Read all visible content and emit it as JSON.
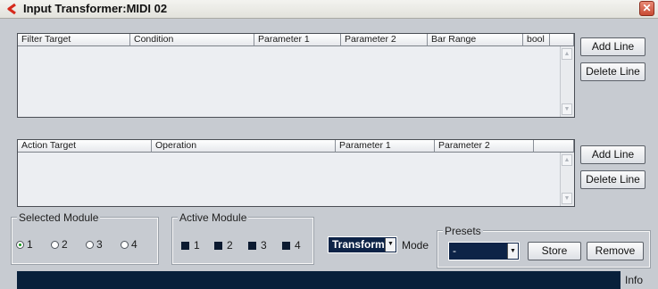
{
  "window": {
    "title": "Input Transformer:MIDI 02",
    "close_glyph": "✕"
  },
  "filter_table": {
    "columns": [
      "Filter Target",
      "Condition",
      "Parameter 1",
      "Parameter 2",
      "Bar Range",
      "bool"
    ]
  },
  "action_table": {
    "columns": [
      "Action Target",
      "Operation",
      "Parameter 1",
      "Parameter 2"
    ]
  },
  "filter_buttons": {
    "add": "Add Line",
    "delete": "Delete Line"
  },
  "action_buttons": {
    "add": "Add Line",
    "delete": "Delete Line"
  },
  "selected_module": {
    "label": "Selected Module",
    "options": [
      "1",
      "2",
      "3",
      "4"
    ],
    "selected_index": 0
  },
  "active_module": {
    "label": "Active Module",
    "options": [
      "1",
      "2",
      "3",
      "4"
    ]
  },
  "mode": {
    "value": "Transform",
    "label": "Mode"
  },
  "presets": {
    "label": "Presets",
    "value": "-",
    "store": "Store",
    "remove": "Remove"
  },
  "info": {
    "label": "Info"
  },
  "colors": {
    "accent_dark": "#0d2347",
    "background": "#c7cbd1",
    "radio_selected": "#139a19"
  }
}
